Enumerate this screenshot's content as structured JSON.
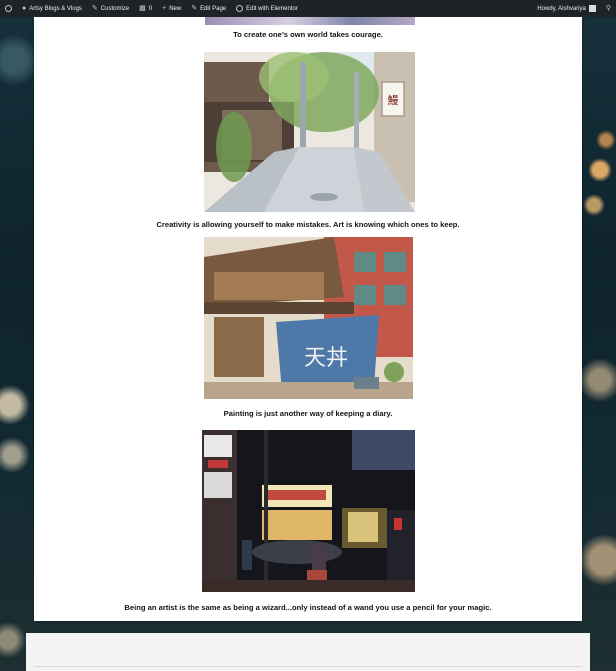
{
  "admin_bar": {
    "site_name": "Artsy Blogs & Vlogs",
    "customize": "Customize",
    "comments_count": "0",
    "new_label": "New",
    "edit_page": "Edit Page",
    "edit_elementor": "Edit with Elementor",
    "howdy": "Howdy, Aishvariya"
  },
  "gallery": {
    "captions": [
      "To create one’s own world takes courage.",
      "Creativity is allowing yourself to make mistakes. Art is knowing which ones to keep.",
      "Painting is just another way of keeping a diary.",
      "Being an artist is the same as being a wizard...only instead of a wand you use a pencil for your magic."
    ],
    "sign_text_alley": "鰻",
    "sign_text_shop": "天丼"
  },
  "colors": {
    "admin_bar": "#1d2327",
    "card": "#ffffff",
    "caption_text": "#141414"
  }
}
